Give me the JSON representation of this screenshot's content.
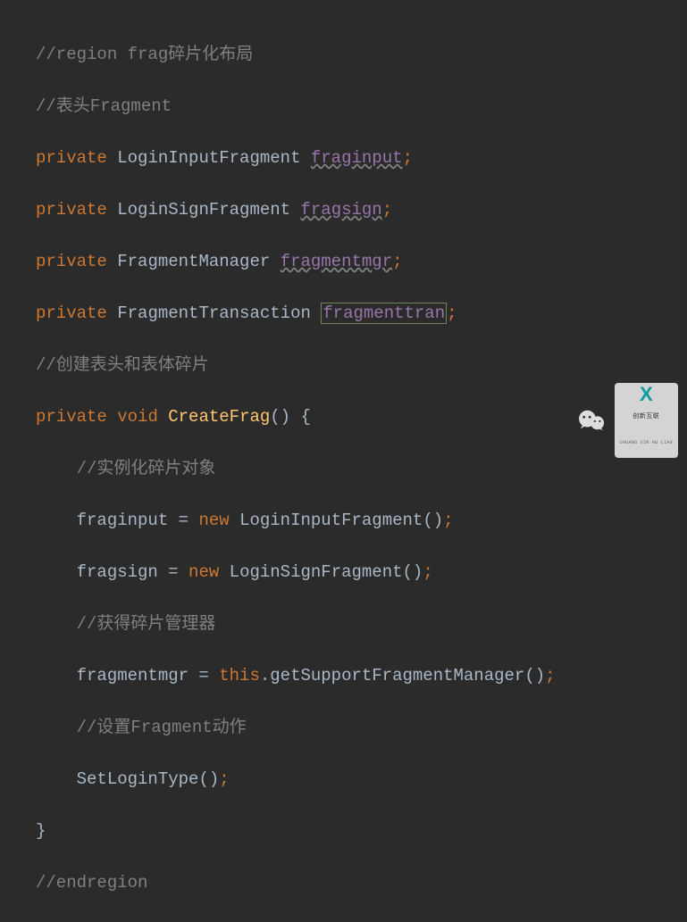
{
  "code": {
    "l1_comment": "//region frag碎片化布局",
    "l2_comment": "//表头Fragment",
    "l3_kw": "private",
    "l3_type": "LoginInputFragment",
    "l3_var": "fraginput",
    "l4_kw": "private",
    "l4_type": "LoginSignFragment",
    "l4_var": "fragsign",
    "l5_kw": "private",
    "l5_type": "FragmentManager",
    "l5_var": "fragmentmgr",
    "l6_kw": "private",
    "l6_type": "FragmentTransaction",
    "l6_var": "fragmenttran",
    "l7_comment": "//创建表头和表体碎片",
    "l8_kw1": "private",
    "l8_kw2": "void",
    "l8_method": "CreateFrag",
    "l9_comment": "//实例化碎片对象",
    "l10_var": "fraginput",
    "l10_kw": "new",
    "l10_type": "LoginInputFragment",
    "l11_var": "fragsign",
    "l11_kw": "new",
    "l11_type": "LoginSignFragment",
    "l12_comment": "//获得碎片管理器",
    "l13_var": "fragmentmgr",
    "l13_this": "this",
    "l13_call": "getSupportFragmentManager",
    "l14_comment": "//设置Fragment动作",
    "l15_call": "SetLoginType",
    "l17_comment": "//endregion"
  },
  "watermark": {
    "logo_main": "创新互联",
    "logo_sub": "CHUANG XIN HU LIAN"
  }
}
